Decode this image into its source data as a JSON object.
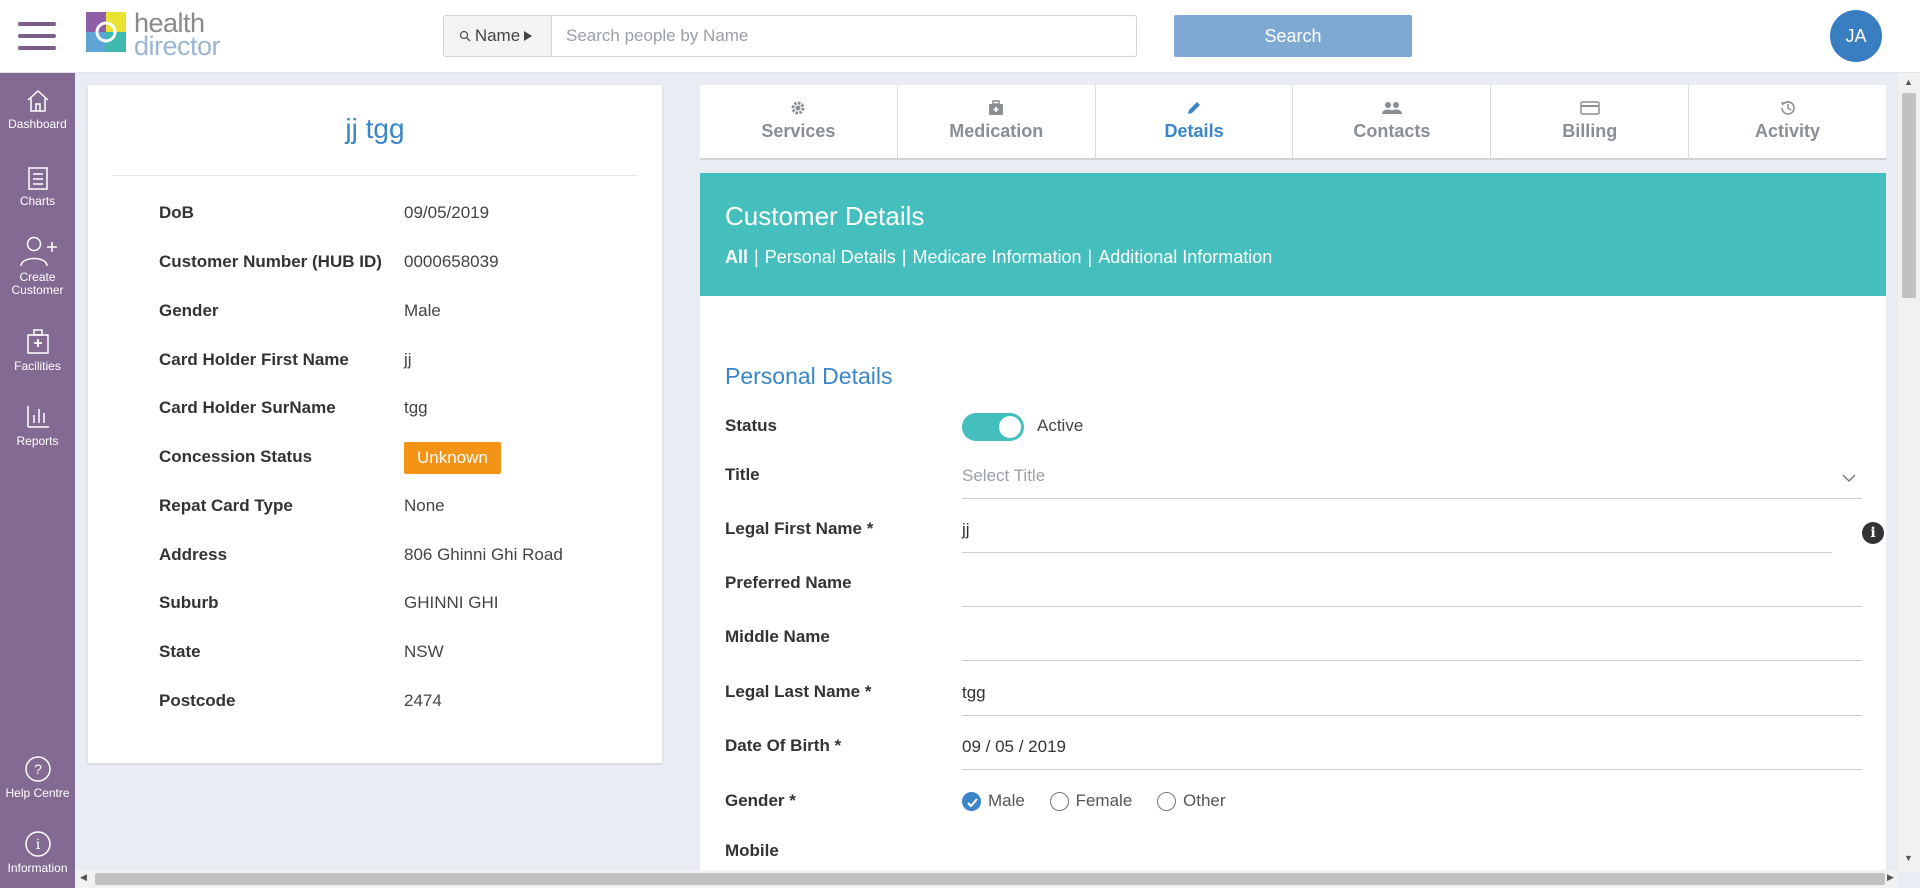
{
  "header": {
    "logo_line1": "health",
    "logo_line2": "director",
    "search_type_label": "Name",
    "search_placeholder": "Search people by Name",
    "search_button": "Search",
    "user_initials": "JA"
  },
  "sidebar": {
    "items": [
      {
        "label": "Dashboard",
        "icon": "home-icon"
      },
      {
        "label": "Charts",
        "icon": "charts-icon"
      },
      {
        "label": "Create",
        "label2": "Customer",
        "icon": "add-user-icon"
      },
      {
        "label": "Facilities",
        "icon": "facilities-icon"
      },
      {
        "label": "Reports",
        "icon": "reports-icon"
      }
    ],
    "bottom_items": [
      {
        "label": "Help Centre",
        "icon": "help-icon"
      },
      {
        "label": "Information",
        "icon": "info-icon"
      }
    ]
  },
  "profile": {
    "name": "jj tgg",
    "fields": [
      {
        "label": "DoB",
        "value": "09/05/2019"
      },
      {
        "label": "Customer Number (HUB ID)",
        "value": "0000658039"
      },
      {
        "label": "Gender",
        "value": "Male"
      },
      {
        "label": "Card Holder First Name",
        "value": "jj"
      },
      {
        "label": "Card Holder SurName",
        "value": "tgg"
      },
      {
        "label": "Concession Status",
        "value": "Unknown"
      },
      {
        "label": "Repat Card Type",
        "value": "None"
      },
      {
        "label": "Address",
        "value": "806 Ghinni Ghi Road"
      },
      {
        "label": "Suburb",
        "value": "GHINNI GHI"
      },
      {
        "label": "State",
        "value": "NSW"
      },
      {
        "label": "Postcode",
        "value": "2474"
      }
    ],
    "concession_color": "#f39417"
  },
  "tabs": [
    {
      "label": "Services",
      "icon": "gear-icon"
    },
    {
      "label": "Medication",
      "icon": "medkit-icon"
    },
    {
      "label": "Details",
      "icon": "pencil-icon",
      "active": true
    },
    {
      "label": "Contacts",
      "icon": "users-icon"
    },
    {
      "label": "Billing",
      "icon": "card-icon"
    },
    {
      "label": "Activity",
      "icon": "history-icon"
    }
  ],
  "details": {
    "title": "Customer Details",
    "links": [
      "All",
      "Personal Details",
      "Medicare Information",
      "Additional Information"
    ],
    "section_title": "Personal Details",
    "status_label": "Status",
    "status_value": "Active",
    "title_label": "Title",
    "title_placeholder": "Select Title",
    "legal_first_label": "Legal First Name *",
    "legal_first_value": "jj",
    "preferred_label": "Preferred Name",
    "preferred_value": "",
    "middle_label": "Middle Name",
    "middle_value": "",
    "legal_last_label": "Legal Last Name *",
    "legal_last_value": "tgg",
    "dob_label": "Date Of Birth *",
    "dob_value": "09 / 05 / 2019",
    "gender_label": "Gender *",
    "gender_options": [
      "Male",
      "Female",
      "Other"
    ],
    "gender_selected": "Male",
    "mobile_label": "Mobile",
    "accent_color": "#45bfbe"
  }
}
